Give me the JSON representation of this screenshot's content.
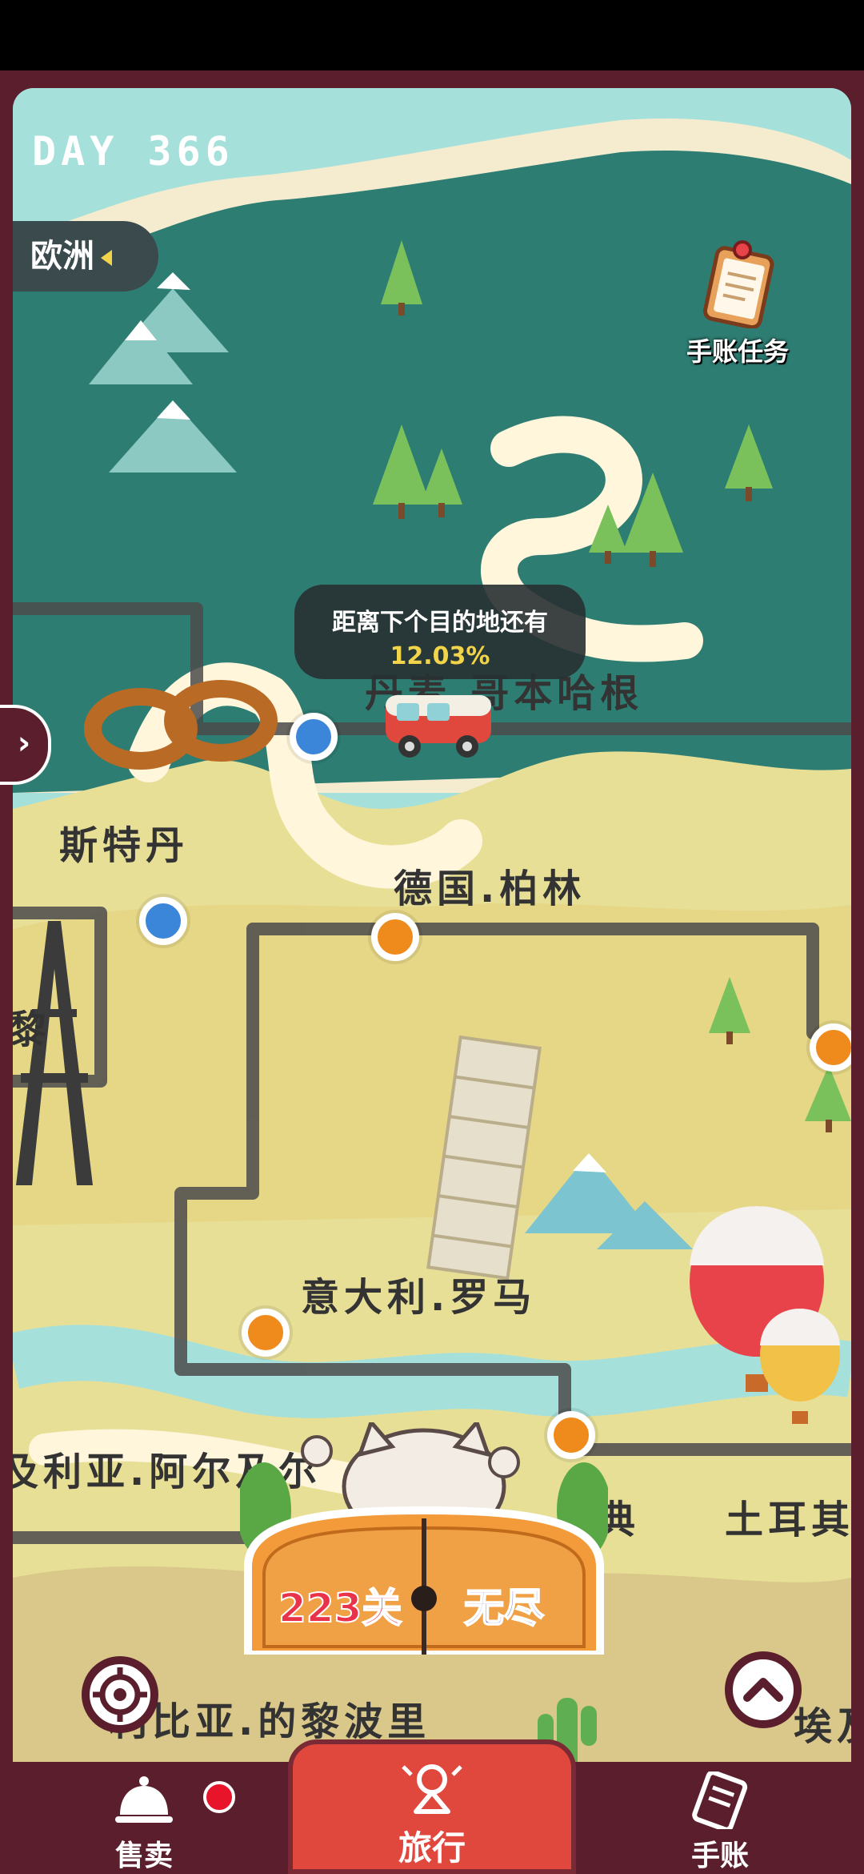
{
  "hud": {
    "day_label": "DAY 366",
    "region_label": "欧洲"
  },
  "task": {
    "label": "手账任务",
    "icon": "clipboard-icon"
  },
  "progress_tooltip": {
    "line1": "距离下个目的地还有",
    "value": "12.03%"
  },
  "cities": {
    "copenhagen": "丹麦.哥本哈根",
    "amsterdam": "斯特丹",
    "berlin": "德国.柏林",
    "paris_partial": "黎",
    "rome": "意大利.罗马",
    "algeria": "及利亚.阿尔及尔",
    "sweden_partial": "典",
    "turkey_partial": "土耳其",
    "libya": "利比亚.的黎波里",
    "partial_right": "埃及"
  },
  "mode_selector": {
    "levels_label": "223关",
    "endless_label": "无尽"
  },
  "nav": {
    "sell_label": "售卖",
    "travel_label": "旅行",
    "journal_label": "手账"
  },
  "colors": {
    "frame": "#5a1e2c",
    "sea": "#a6e0da",
    "forest": "#2e7d73",
    "land": "#e8df97",
    "accent": "#e0473d"
  }
}
